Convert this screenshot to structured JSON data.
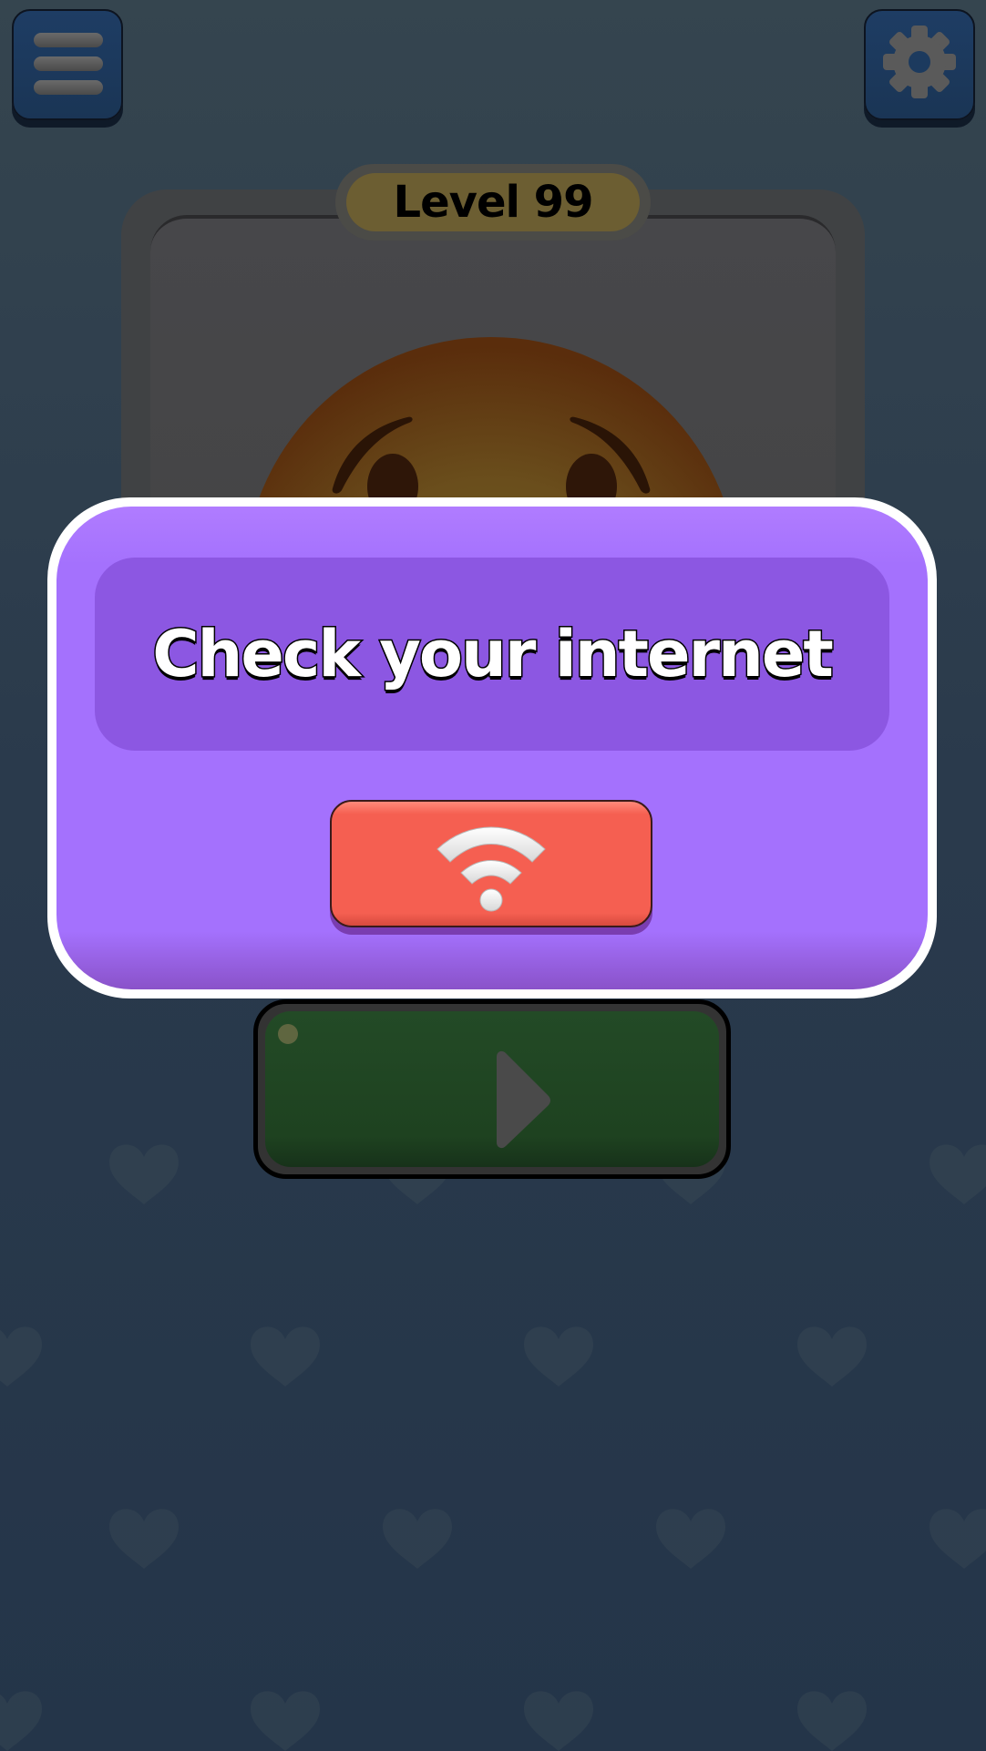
{
  "game": {
    "level_label": "Level 99"
  },
  "dialog": {
    "title": "Check your internet",
    "retry_icon": "wifi-icon"
  },
  "top_bar": {
    "menu_icon": "hamburger-menu-icon",
    "settings_icon": "gear-icon"
  },
  "play_button": {
    "icon": "play-icon"
  },
  "colors": {
    "background": "#2a3a4c",
    "dialog_purple": "#a471fd",
    "dialog_inner": "#8c57e2",
    "retry_red": "#f55f51",
    "play_green": "#1e4220",
    "level_gold": "#6c5e32"
  }
}
